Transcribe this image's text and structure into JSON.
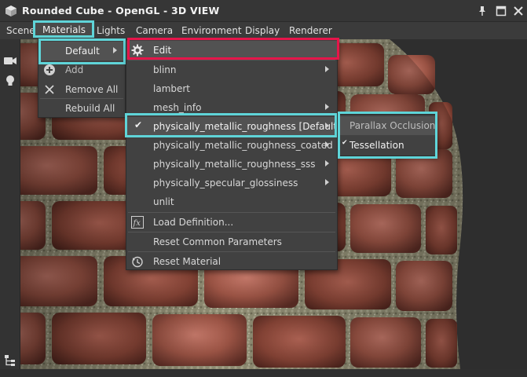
{
  "window": {
    "title": "Rounded Cube - OpenGL - 3D VIEW"
  },
  "menubar": {
    "items": [
      {
        "name": "scene",
        "label": "Scene"
      },
      {
        "name": "materials",
        "label": "Materials"
      },
      {
        "name": "lights",
        "label": "Lights"
      },
      {
        "name": "camera",
        "label": "Camera"
      },
      {
        "name": "environment",
        "label": "Environment"
      },
      {
        "name": "display",
        "label": "Display"
      },
      {
        "name": "renderer",
        "label": "Renderer"
      }
    ]
  },
  "materials_menu": {
    "default": "Default",
    "add": "Add",
    "remove_all": "Remove All",
    "rebuild_all": "Rebuild All"
  },
  "default_submenu": {
    "edit": "Edit",
    "shaders": [
      {
        "label": "blinn",
        "has_submenu": true
      },
      {
        "label": "lambert",
        "has_submenu": false
      },
      {
        "label": "mesh_info",
        "has_submenu": true
      },
      {
        "label": "physically_metallic_roughness [Default]",
        "has_submenu": true,
        "checked": true
      },
      {
        "label": "physically_metallic_roughness_coated",
        "has_submenu": true
      },
      {
        "label": "physically_metallic_roughness_sss",
        "has_submenu": true
      },
      {
        "label": "physically_specular_glossiness",
        "has_submenu": true
      },
      {
        "label": "unlit",
        "has_submenu": false
      }
    ],
    "load_definition": "Load Definition...",
    "reset_common_parameters": "Reset Common Parameters",
    "reset_material": "Reset Material"
  },
  "pmr_submenu": {
    "parallax_occlusion": "Parallax Occlusion",
    "tessellation": "Tessellation"
  },
  "colors": {
    "highlight_cyan": "#5fd4d8",
    "highlight_red": "#e5154a",
    "menu_bg": "#414141",
    "titlebar_bg": "#363636"
  },
  "icons": {
    "edit": "gear-icon",
    "add": "plus-circle-icon",
    "remove_all": "x-icon",
    "load_definition": "fx-icon",
    "reset_material": "reset-icon"
  }
}
